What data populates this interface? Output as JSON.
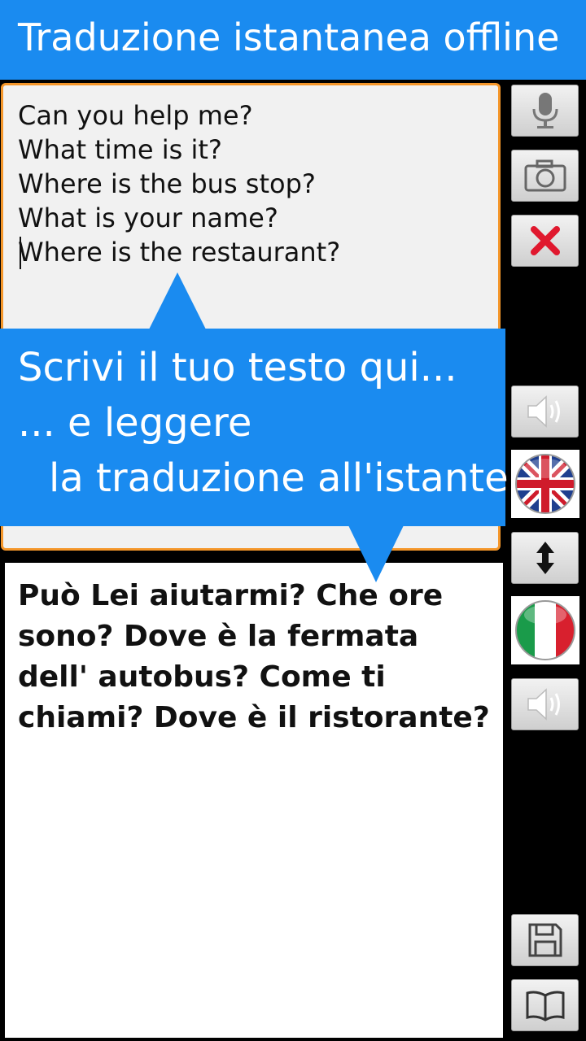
{
  "header": {
    "title": "Traduzione istantanea offline"
  },
  "source": {
    "lines": [
      "Can you help me?",
      "What time is it?",
      "Where is the bus stop?",
      "What is your name?",
      "Where is the restaurant?"
    ]
  },
  "tooltip": {
    "line1": "Scrivi il tuo testo qui...",
    "line2": "... e leggere",
    "line3": "la traduzione all'istante!"
  },
  "target": {
    "text": "Può Lei aiutarmi? Che ore sono? Dove è la fermata dell' autobus? Come ti chiami? Dove è il ristorante?"
  },
  "icons": {
    "mic": "microphone-icon",
    "camera": "camera-icon",
    "clear": "close-icon",
    "speak": "speaker-icon",
    "swap": "swap-vertical-icon",
    "save": "save-icon",
    "book": "book-icon"
  },
  "colors": {
    "accent": "#1a8bf0",
    "input_border": "#f4962a",
    "clear_red": "#e0182e"
  }
}
